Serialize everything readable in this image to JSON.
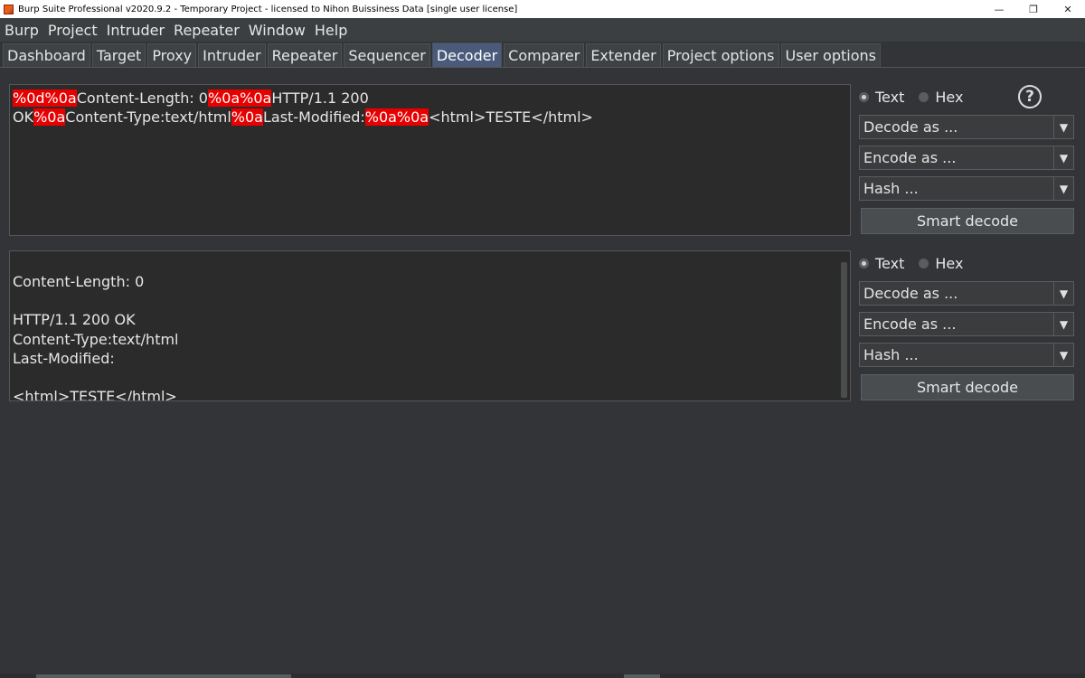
{
  "window": {
    "title": "Burp Suite Professional v2020.9.2 - Temporary Project - licensed to Nihon Buissiness Data [single user license]",
    "minimize_glyph": "—",
    "restore_glyph": "❐",
    "close_glyph": "✕"
  },
  "menu": [
    "Burp",
    "Project",
    "Intruder",
    "Repeater",
    "Window",
    "Help"
  ],
  "tabs": [
    "Dashboard",
    "Target",
    "Proxy",
    "Intruder",
    "Repeater",
    "Sequencer",
    "Decoder",
    "Comparer",
    "Extender",
    "Project options",
    "User options"
  ],
  "active_tab": "Decoder",
  "input_panel": {
    "line1": {
      "hl1": "%0d%0a",
      "t1": "Content-Length: 0",
      "hl2": "%0a%0a",
      "t2": "HTTP/1.1 200"
    },
    "line2": {
      "t1": "OK",
      "hl1": "%0a",
      "t2": "Content-Type:text/html",
      "hl2": "%0a",
      "t3": "Last-Modified:",
      "hl3": "%0a%0a",
      "t4": "<html>TESTE</html>"
    }
  },
  "output_panel": {
    "lines": [
      "",
      "Content-Length: 0",
      "",
      "HTTP/1.1 200 OK",
      "Content-Type:text/html",
      "Last-Modified:",
      "",
      "<html>TESTE</html>"
    ]
  },
  "controls": {
    "text_label": "Text",
    "hex_label": "Hex",
    "help_glyph": "?",
    "decode_as": "Decode as ...",
    "encode_as": "Encode as ...",
    "hash": "Hash ...",
    "arrow_glyph": "▼",
    "smart_decode": "Smart decode"
  }
}
